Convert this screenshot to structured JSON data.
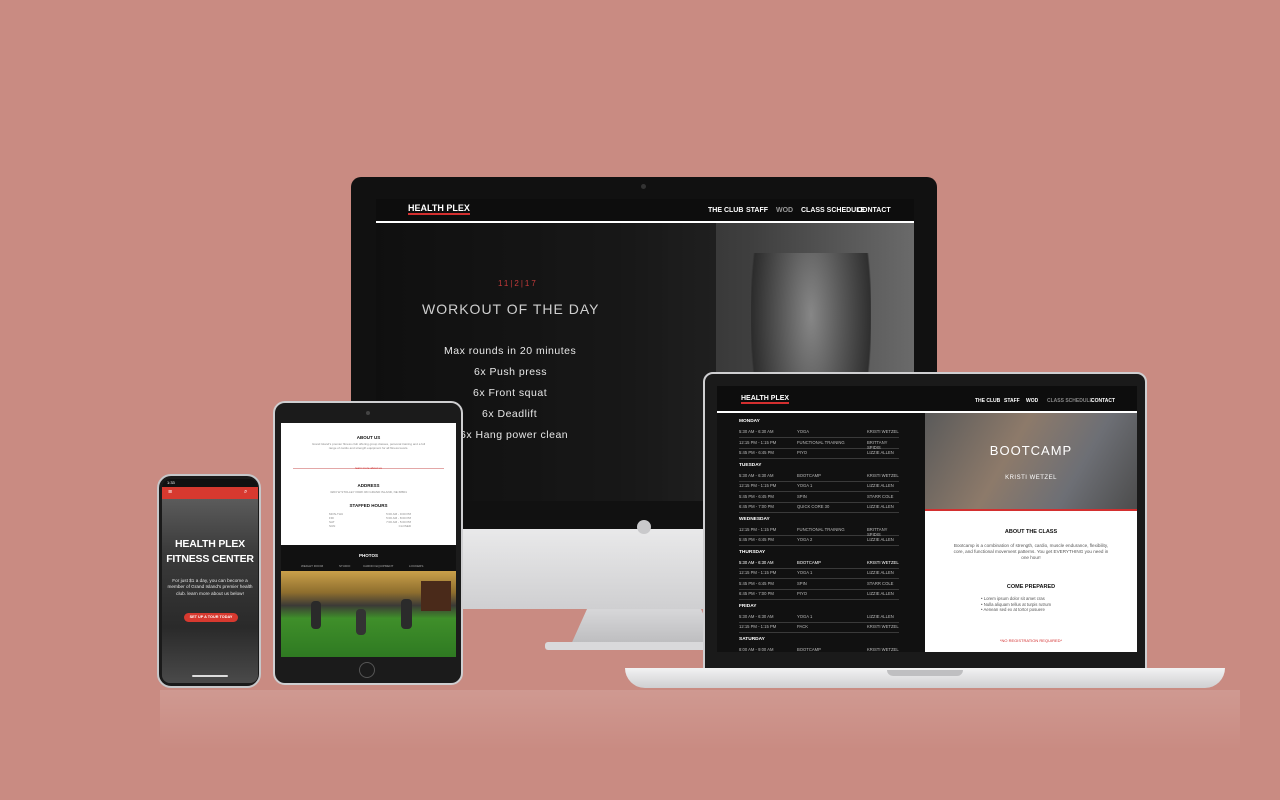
{
  "imac": {
    "logo": "HEALTH PLEX",
    "nav": [
      "THE CLUB",
      "STAFF",
      "WOD",
      "CLASS SCHEDULE",
      "CONTACT"
    ],
    "date": "11|2|17",
    "title": "WORKOUT OF THE DAY",
    "workout": [
      "Max rounds in 20 minutes",
      "6x Push press",
      "6x Front squat",
      "6x Deadlift",
      "6x Hang power clean"
    ]
  },
  "laptop": {
    "logo": "HEALTH PLEX",
    "nav": [
      "THE CLUB",
      "STAFF",
      "WOD",
      "CLASS SCHEDULE",
      "CONTACT"
    ],
    "schedule": [
      {
        "day": "MONDAY",
        "rows": [
          {
            "time": "5:30 AM - 6:30 AM",
            "class": "YOGA",
            "coach": "KRISTI WETZEL"
          },
          {
            "time": "12:15 PM - 1:15 PM",
            "class": "FUNCTIONAL TRAINING",
            "coach": "BRITTANY SPIDIS"
          },
          {
            "time": "5:45 PM - 6:45 PM",
            "class": "PIYO",
            "coach": "LIZZIE ALLEN"
          }
        ]
      },
      {
        "day": "TUESDAY",
        "rows": [
          {
            "time": "5:30 AM - 6:30 AM",
            "class": "BOOTCAMP",
            "coach": "KRISTI WETZEL"
          },
          {
            "time": "12:15 PM - 1:15 PM",
            "class": "YOGA 1",
            "coach": "LIZZIE ALLEN"
          },
          {
            "time": "5:45 PM - 6:45 PM",
            "class": "SPIN",
            "coach": "STARR COLE"
          },
          {
            "time": "6:45 PM - 7:00 PM",
            "class": "QUICK CORE 30",
            "coach": "LIZZIE ALLEN"
          }
        ]
      },
      {
        "day": "WEDNESDAY",
        "rows": [
          {
            "time": "12:15 PM - 1:15 PM",
            "class": "FUNCTIONAL TRAINING",
            "coach": "BRITTANY SPIDIS"
          },
          {
            "time": "5:45 PM - 6:45 PM",
            "class": "YOGA 2",
            "coach": "LIZZIE ALLEN"
          }
        ]
      },
      {
        "day": "THURSDAY",
        "rows": [
          {
            "time": "5:30 AM - 6:30 AM",
            "class": "BOOTCAMP",
            "coach": "KRISTI WETZEL",
            "highlight": true
          },
          {
            "time": "12:15 PM - 1:15 PM",
            "class": "YOGA 1",
            "coach": "LIZZIE ALLEN"
          },
          {
            "time": "5:45 PM - 6:45 PM",
            "class": "SPIN",
            "coach": "STARR COLE"
          },
          {
            "time": "6:45 PM - 7:00 PM",
            "class": "PIYO",
            "coach": "LIZZIE ALLEN"
          }
        ]
      },
      {
        "day": "FRIDAY",
        "rows": [
          {
            "time": "5:30 AM - 6:30 AM",
            "class": "YOGA 1",
            "coach": "LIZZIE ALLEN"
          },
          {
            "time": "12:15 PM - 1:15 PM",
            "class": "PACK",
            "coach": "KRISTI WETZEL"
          }
        ]
      },
      {
        "day": "SATURDAY",
        "rows": [
          {
            "time": "8:00 AM - 9:00 AM",
            "class": "BOOTCAMP",
            "coach": "KRISTI WETZEL"
          }
        ]
      }
    ],
    "class_title": "BOOTCAMP",
    "class_coach": "KRISTI WETZEL",
    "about_heading": "ABOUT THE CLASS",
    "about_text": "Bootcamp is a combination of strength, cardio, muscle endurance, flexibility, core, and functional movement patterns. You get EVERYTHING you need in one hour!",
    "prepared_heading": "COME PREPARED",
    "prepared_items": [
      "Lorem ipsum dolor sit amet cras",
      "Nulla aliquam tellus at turpis rutrum",
      "Aenean sed ex at tortor posuere"
    ],
    "note": "*NO REGISTRATION REQUIRED*"
  },
  "tablet": {
    "about_heading": "ABOUT US",
    "about_text": "Grand Island's premier fitness club offering group classes, personal training and a full range of cardio and strength equipment for all fitness levels.",
    "link": "learn more about us",
    "address_heading": "ADDRESS",
    "address": "3203 W STOLLEY PARK RD GRAND ISLAND, NE 68801",
    "hours_heading": "STAFFED HOURS",
    "hours": [
      [
        "MON-THU",
        "5:00 AM - 9:00 PM"
      ],
      [
        "FRI",
        "5:00 AM - 8:00 PM"
      ],
      [
        "SAT",
        "7:00 AM - 5:00 PM"
      ],
      [
        "SUN",
        "CLOSED"
      ]
    ],
    "photos_heading": "PHOTOS",
    "photo_tabs": [
      "WEIGHT ROOM",
      "STUDIO",
      "CARDIO EQUIPMENT",
      "LOCKERS"
    ]
  },
  "phone": {
    "status_time": "1:33",
    "title_line1": "HEALTH PLEX",
    "title_line2": "FITNESS CENTER",
    "text": "For just $1 a day, you can become a member of Grand Island's premier health club. learn more about us below!",
    "button": "SET UP A TOUR TODAY"
  }
}
